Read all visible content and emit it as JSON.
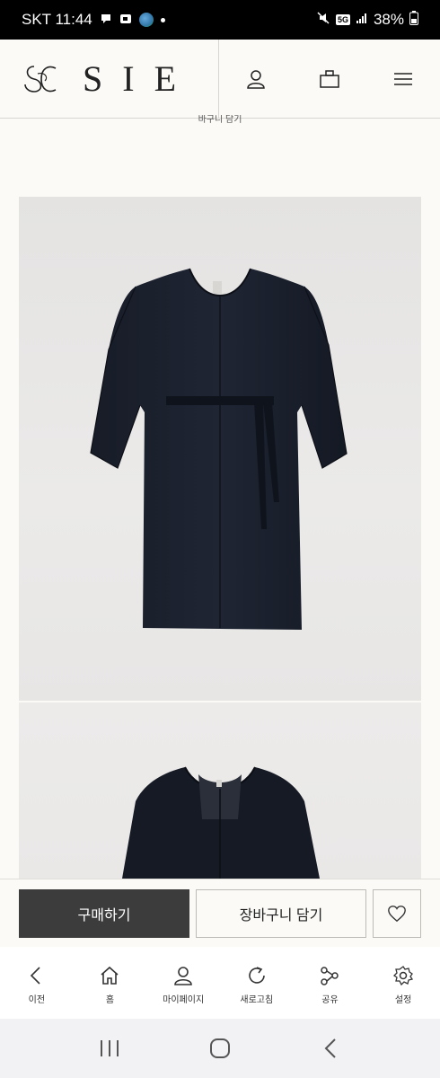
{
  "status_bar": {
    "carrier_time": "SKT 11:44",
    "network": "5G",
    "battery": "38%"
  },
  "header": {
    "logo_text": "SIE",
    "sub_label": "바구니 담기"
  },
  "actions": {
    "buy_label": "구매하기",
    "cart_label": "장바구니 담기"
  },
  "browser_nav": [
    {
      "label": "이전",
      "icon": "back-icon"
    },
    {
      "label": "홈",
      "icon": "home-icon"
    },
    {
      "label": "마이페이지",
      "icon": "person-icon"
    },
    {
      "label": "새로고침",
      "icon": "refresh-icon"
    },
    {
      "label": "공유",
      "icon": "share-icon"
    },
    {
      "label": "설정",
      "icon": "gear-icon"
    }
  ],
  "colors": {
    "accent": "#3c3c3c",
    "background": "#fbfaf7"
  }
}
